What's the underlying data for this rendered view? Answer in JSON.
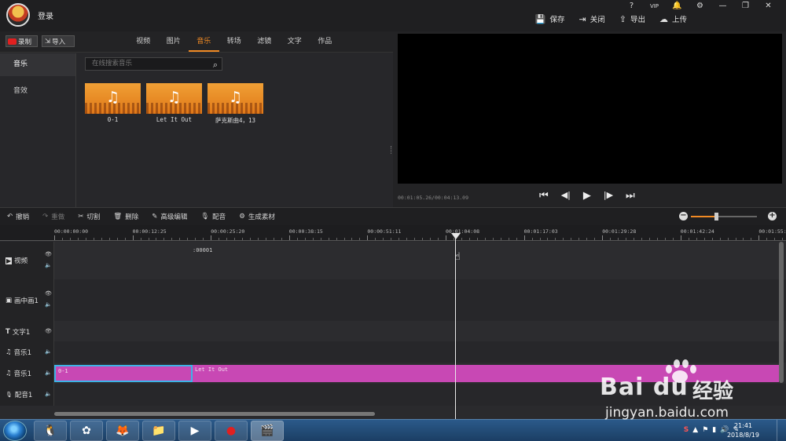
{
  "header": {
    "login_label": "登录",
    "system_icons": [
      "help-icon",
      "vip-icon",
      "bell-icon",
      "gear-icon",
      "minimize-icon",
      "maximize-icon",
      "close-icon"
    ],
    "system_labels": [
      "?",
      "VIP",
      "🔔",
      "⚙",
      "—",
      "❐",
      "✕"
    ],
    "actions": [
      {
        "icon": "save-icon",
        "glyph": "💾",
        "label": "保存"
      },
      {
        "icon": "exit-icon",
        "glyph": "⇥",
        "label": "关闭"
      },
      {
        "icon": "export-icon",
        "glyph": "⇪",
        "label": "导出"
      },
      {
        "icon": "upload-cloud-icon",
        "glyph": "☁",
        "label": "上传"
      }
    ]
  },
  "library": {
    "record_label": "录制",
    "import_label": "导入",
    "tabs": [
      "视频",
      "图片",
      "音乐",
      "转场",
      "滤镜",
      "文字",
      "作品"
    ],
    "active_tab": "音乐",
    "categories": [
      "音乐",
      "音效"
    ],
    "active_category": "音乐",
    "search_placeholder": "在线搜索音乐",
    "items": [
      {
        "name": "0-1"
      },
      {
        "name": "Let It Out"
      },
      {
        "name": "萨克斯曲4，13"
      }
    ]
  },
  "preview": {
    "time_readout": "00:01:05.26/00:04:13.09",
    "controls": [
      "skip-start-icon",
      "frame-back-icon",
      "play-icon",
      "frame-forward-icon",
      "skip-end-icon"
    ],
    "control_glyphs": [
      "⏮",
      "◀|",
      "▶",
      "|▶",
      "⏭"
    ]
  },
  "toolbar": {
    "tools": [
      {
        "icon": "undo-icon",
        "glyph": "↶",
        "label": "撤销",
        "enabled": true
      },
      {
        "icon": "redo-icon",
        "glyph": "↷",
        "label": "重做",
        "enabled": false
      },
      {
        "icon": "cut-icon",
        "glyph": "✂",
        "label": "切割",
        "enabled": true
      },
      {
        "icon": "delete-icon",
        "glyph": "🗑",
        "label": "删除",
        "enabled": true
      },
      {
        "icon": "edit-icon",
        "glyph": "✎",
        "label": "高级编辑",
        "enabled": true
      },
      {
        "icon": "microphone-icon",
        "glyph": "🎙",
        "label": "配音",
        "enabled": true
      },
      {
        "icon": "generate-icon",
        "glyph": "⚙",
        "label": "生成素材",
        "enabled": true
      }
    ],
    "zoom_level": 0.38
  },
  "timeline": {
    "ruler_ticks": [
      "00:00:00:00",
      "00:00:12:25",
      "00:00:25:20",
      "00:00:38:15",
      "00:00:51:11",
      "00:01:04:08",
      "00:01:17:03",
      "00:01:29:28",
      "00:01:42:24",
      "00:01:55:"
    ],
    "tracks": [
      {
        "label": "视频",
        "icon": "video-track-icon",
        "glyph": "▶"
      },
      {
        "label": "画中画1",
        "icon": "pip-track-icon",
        "glyph": "▣"
      },
      {
        "label": "文字1",
        "icon": "text-track-icon",
        "glyph": "T"
      },
      {
        "label": "音乐1",
        "icon": "music-track-icon",
        "glyph": "♫"
      },
      {
        "label": "音乐1",
        "icon": "music-track-icon",
        "glyph": "♫"
      },
      {
        "label": "配音1",
        "icon": "mic-track-icon",
        "glyph": "🎙"
      }
    ],
    "video_marker": ":00001",
    "clips": [
      {
        "label": "0-1",
        "selected": true
      },
      {
        "label": "Let It Out",
        "selected": false
      }
    ]
  },
  "taskbar": {
    "apps": [
      "qq-icon",
      "media-player-icon",
      "firefox-icon",
      "folder-icon",
      "media-icon",
      "record-icon",
      "editor-icon"
    ],
    "app_glyphs": [
      "🐧",
      "✿",
      "🦊",
      "📁",
      "▶",
      "●",
      "🎬"
    ],
    "time": "21:41",
    "date": "2018/8/19",
    "tray_glyphs": [
      "S",
      "▲",
      "⚑",
      "▮",
      "🔊",
      "✎"
    ]
  },
  "watermark": {
    "brand": "Bai du",
    "cn": "经验",
    "url": "jingyan.baidu.com"
  },
  "colors": {
    "accent": "#f08a24",
    "clip": "#c848b4",
    "selection": "#3cb4e6"
  }
}
